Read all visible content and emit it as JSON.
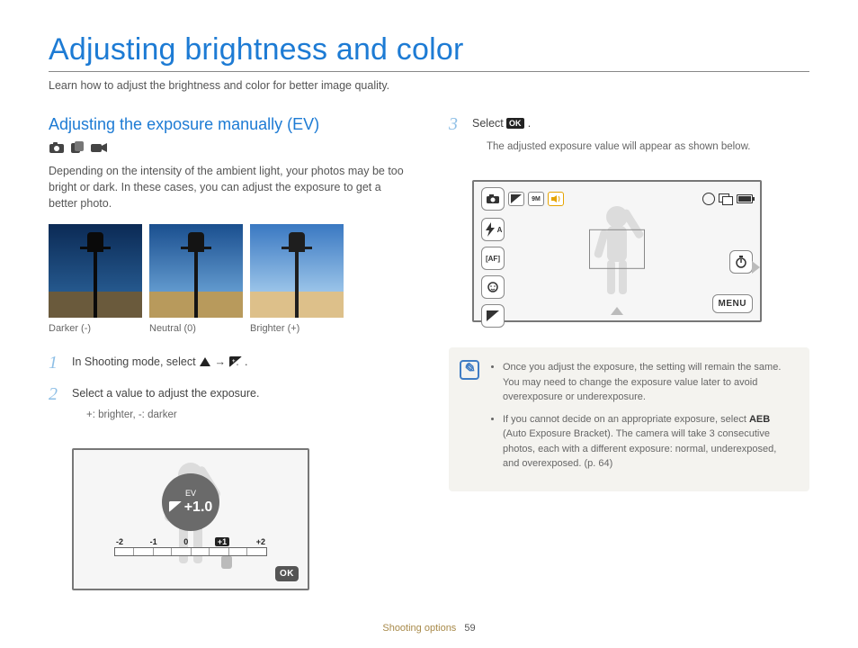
{
  "page": {
    "title": "Adjusting brightness and color",
    "intro": "Learn how to adjust the brightness and color for better image quality."
  },
  "left": {
    "section_title": "Adjusting the exposure manually (EV)",
    "para": "Depending on the intensity of the ambient light, your photos may be too bright or dark. In these cases, you can adjust the exposure to get a better photo.",
    "thumb_labels": {
      "darker": "Darker (-)",
      "neutral": "Neutral (0)",
      "brighter": "Brighter (+)"
    },
    "steps": {
      "s1_num": "1",
      "s1_a": "In Shooting mode, select ",
      "s1_b": " → ",
      "s1_c": ".",
      "s2_num": "2",
      "s2": "Select a value to adjust the exposure.",
      "s2_sub": "+: brighter, -: darker"
    },
    "lcd": {
      "ev_label": "EV",
      "ev_value": "+1.0",
      "ticks": {
        "m2": "-2",
        "m1": "-1",
        "z": "0",
        "p1": "+1",
        "p2": "+2"
      },
      "ok": "OK"
    }
  },
  "right": {
    "s3_num": "3",
    "s3_a": "Select ",
    "s3_b": ".",
    "s3_sub": "The adjusted exposure value will appear as shown below.",
    "lcd": {
      "menu": "MENU",
      "flash": "A",
      "af": "AF"
    },
    "note": {
      "b1": "Once you adjust the exposure, the setting will remain the same. You may need to change the exposure value later to avoid overexposure or underexposure.",
      "b2a": "If you cannot decide on an appropriate exposure, select ",
      "b2_aeb": "AEB",
      "b2b": " (Auto Exposure Bracket). The camera will take 3 consecutive photos, each with a different exposure: normal, underexposed, and overexposed. (p. 64)"
    }
  },
  "footer": {
    "section": "Shooting options",
    "page": "59"
  }
}
